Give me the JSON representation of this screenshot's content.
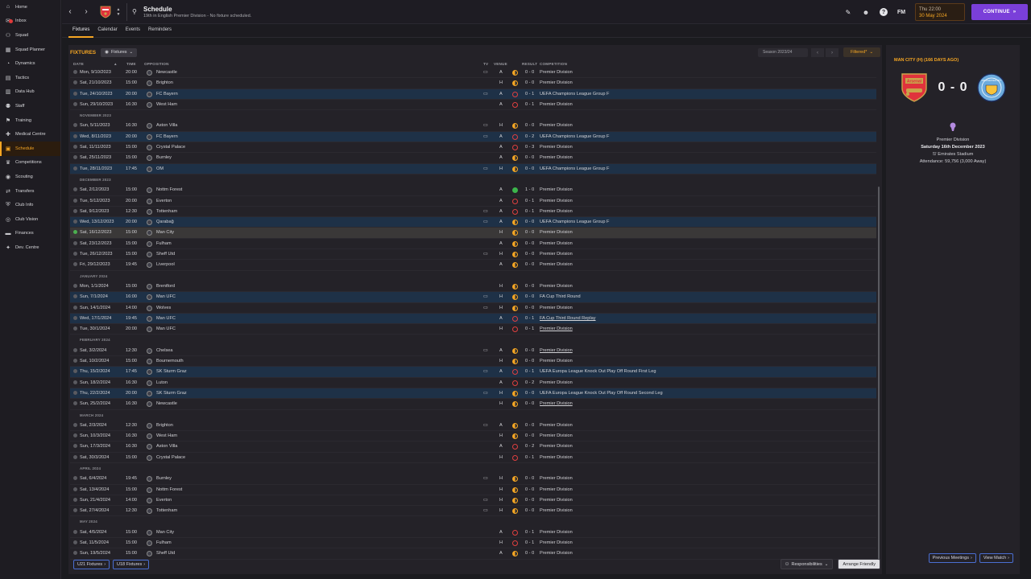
{
  "sidebar": {
    "items": [
      {
        "label": "Home",
        "icon": "home-icon",
        "glyph": "⌂"
      },
      {
        "label": "Inbox",
        "icon": "inbox-icon",
        "glyph": "✉",
        "badge": true
      },
      {
        "label": "Squad",
        "icon": "squad-icon",
        "glyph": "⚇"
      },
      {
        "label": "Squad Planner",
        "icon": "squad-planner-icon",
        "glyph": "▦"
      },
      {
        "label": "Dynamics",
        "icon": "dynamics-icon",
        "glyph": "◔"
      },
      {
        "label": "Tactics",
        "icon": "tactics-icon",
        "glyph": "▤"
      },
      {
        "label": "Data Hub",
        "icon": "data-hub-icon",
        "glyph": "▥"
      },
      {
        "label": "Staff",
        "icon": "staff-icon",
        "glyph": "⚉"
      },
      {
        "label": "Training",
        "icon": "training-icon",
        "glyph": "⚑"
      },
      {
        "label": "Medical Centre",
        "icon": "medical-icon",
        "glyph": "✚"
      },
      {
        "label": "Schedule",
        "icon": "calendar-icon",
        "glyph": "▣",
        "active": true
      },
      {
        "label": "Competitions",
        "icon": "trophy-icon",
        "glyph": "♛"
      },
      {
        "label": "Scouting",
        "icon": "scouting-icon",
        "glyph": "◉"
      },
      {
        "label": "Transfers",
        "icon": "transfers-icon",
        "glyph": "⇄"
      },
      {
        "label": "Club Info",
        "icon": "club-info-icon",
        "glyph": "⛨"
      },
      {
        "label": "Club Vision",
        "icon": "club-vision-icon",
        "glyph": "◎"
      },
      {
        "label": "Finances",
        "icon": "finances-icon",
        "glyph": "▬"
      },
      {
        "label": "Dev. Centre",
        "icon": "dev-centre-icon",
        "glyph": "✦"
      }
    ]
  },
  "header": {
    "title": "Schedule",
    "subtitle": "19th in English Premier Division - No fixture scheduled.",
    "date_time": "Thu 22:00",
    "date": "30 May 2024",
    "continue_label": "CONTINUE",
    "fm_label": "FM",
    "help_label": "?"
  },
  "tabs": [
    "Fixtures",
    "Calendar",
    "Events",
    "Reminders"
  ],
  "fixtures": {
    "title": "FIXTURES",
    "filter_label": "Fixtures",
    "season": "Season 2023/24",
    "filtered_label": "Filtered*",
    "columns": {
      "date": "DATE",
      "time": "TIME",
      "opposition": "OPPOSITION",
      "tv": "TV",
      "venue": "VENUE",
      "result": "RESULT",
      "competition": "COMPETITION"
    },
    "rows": [
      {
        "date": "Mon, 9/10/2023",
        "time": "20:00",
        "opp": "Newcastle",
        "tv": true,
        "venue": "A",
        "res": "D",
        "score": "0 - 0",
        "comp": "Premier Division"
      },
      {
        "date": "Sat, 21/10/2023",
        "time": "15:00",
        "opp": "Brighton",
        "tv": false,
        "venue": "H",
        "res": "D",
        "score": "0 - 0",
        "comp": "Premier Division"
      },
      {
        "date": "Tue, 24/10/2023",
        "time": "20:00",
        "opp": "FC Bayern",
        "tv": true,
        "venue": "A",
        "res": "L",
        "score": "0 - 1",
        "comp": "UEFA Champions League Group F",
        "uefa": true
      },
      {
        "date": "Sun, 29/10/2023",
        "time": "16:30",
        "opp": "West Ham",
        "tv": false,
        "venue": "A",
        "res": "L",
        "score": "0 - 1",
        "comp": "Premier Division"
      },
      {
        "section": "NOVEMBER 2023"
      },
      {
        "date": "Sun, 5/11/2023",
        "time": "16:30",
        "opp": "Aston Villa",
        "tv": true,
        "venue": "H",
        "res": "D",
        "score": "0 - 0",
        "comp": "Premier Division"
      },
      {
        "date": "Wed, 8/11/2023",
        "time": "20:00",
        "opp": "FC Bayern",
        "tv": true,
        "venue": "A",
        "res": "L",
        "score": "0 - 2",
        "comp": "UEFA Champions League Group F",
        "uefa": true
      },
      {
        "date": "Sat, 11/11/2023",
        "time": "15:00",
        "opp": "Crystal Palace",
        "tv": false,
        "venue": "A",
        "res": "L",
        "score": "0 - 3",
        "comp": "Premier Division"
      },
      {
        "date": "Sat, 25/11/2023",
        "time": "15:00",
        "opp": "Burnley",
        "tv": false,
        "venue": "A",
        "res": "D",
        "score": "0 - 0",
        "comp": "Premier Division"
      },
      {
        "date": "Tue, 28/11/2023",
        "time": "17:45",
        "opp": "OM",
        "tv": true,
        "venue": "H",
        "res": "D",
        "score": "0 - 0",
        "comp": "UEFA Champions League Group F",
        "uefa": true
      },
      {
        "section": "DECEMBER 2023"
      },
      {
        "date": "Sat, 2/12/2023",
        "time": "15:00",
        "opp": "Nottm Forest",
        "tv": false,
        "venue": "A",
        "res": "W",
        "score": "1 - 0",
        "comp": "Premier Division"
      },
      {
        "date": "Tue, 5/12/2023",
        "time": "20:00",
        "opp": "Everton",
        "tv": false,
        "venue": "A",
        "res": "L",
        "score": "0 - 1",
        "comp": "Premier Division"
      },
      {
        "date": "Sat, 9/12/2023",
        "time": "12:30",
        "opp": "Tottenham",
        "tv": true,
        "venue": "A",
        "res": "L",
        "score": "0 - 1",
        "comp": "Premier Division"
      },
      {
        "date": "Wed, 13/12/2023",
        "time": "20:00",
        "opp": "Qarabağ",
        "tv": true,
        "venue": "A",
        "res": "D",
        "score": "0 - 0",
        "comp": "UEFA Champions League Group F",
        "uefa": true
      },
      {
        "date": "Sat, 16/12/2023",
        "time": "15:00",
        "opp": "Man City",
        "tv": false,
        "venue": "H",
        "res": "D",
        "score": "0 - 0",
        "comp": "Premier Division",
        "selected": true
      },
      {
        "date": "Sat, 23/12/2023",
        "time": "15:00",
        "opp": "Fulham",
        "tv": false,
        "venue": "A",
        "res": "D",
        "score": "0 - 0",
        "comp": "Premier Division"
      },
      {
        "date": "Tue, 26/12/2023",
        "time": "15:00",
        "opp": "Sheff Utd",
        "tv": true,
        "venue": "H",
        "res": "D",
        "score": "0 - 0",
        "comp": "Premier Division"
      },
      {
        "date": "Fri, 29/12/2023",
        "time": "19:45",
        "opp": "Liverpool",
        "tv": false,
        "venue": "A",
        "res": "D",
        "score": "0 - 0",
        "comp": "Premier Division"
      },
      {
        "section": "JANUARY 2024"
      },
      {
        "date": "Mon, 1/1/2024",
        "time": "15:00",
        "opp": "Brentford",
        "tv": false,
        "venue": "H",
        "res": "D",
        "score": "0 - 0",
        "comp": "Premier Division"
      },
      {
        "date": "Sun, 7/1/2024",
        "time": "16:00",
        "opp": "Man UFC",
        "tv": true,
        "venue": "H",
        "res": "D",
        "score": "0 - 0",
        "comp": "FA Cup Third Round",
        "uefa": true
      },
      {
        "date": "Sun, 14/1/2024",
        "time": "14:00",
        "opp": "Wolves",
        "tv": true,
        "venue": "H",
        "res": "D",
        "score": "0 - 0",
        "comp": "Premier Division"
      },
      {
        "date": "Wed, 17/1/2024",
        "time": "19:45",
        "opp": "Man UFC",
        "tv": false,
        "venue": "A",
        "res": "L",
        "score": "0 - 1",
        "comp": "FA Cup Third Round Replay",
        "uefa": true,
        "underline": true
      },
      {
        "date": "Tue, 30/1/2024",
        "time": "20:00",
        "opp": "Man UFC",
        "tv": false,
        "venue": "H",
        "res": "L",
        "score": "0 - 1",
        "comp": "Premier Division",
        "underline": true
      },
      {
        "section": "FEBRUARY 2024"
      },
      {
        "date": "Sat, 3/2/2024",
        "time": "12:30",
        "opp": "Chelsea",
        "tv": true,
        "venue": "A",
        "res": "D",
        "score": "0 - 0",
        "comp": "Premier Division",
        "underline": true
      },
      {
        "date": "Sat, 10/2/2024",
        "time": "15:00",
        "opp": "Bournemouth",
        "tv": false,
        "venue": "H",
        "res": "D",
        "score": "0 - 0",
        "comp": "Premier Division"
      },
      {
        "date": "Thu, 15/2/2024",
        "time": "17:45",
        "opp": "SK Sturm Graz",
        "tv": true,
        "venue": "A",
        "res": "L",
        "score": "0 - 1",
        "comp": "UEFA Europa League Knock Out Play Off Round First Leg",
        "uefa": true
      },
      {
        "date": "Sun, 18/2/2024",
        "time": "16:30",
        "opp": "Luton",
        "tv": false,
        "venue": "A",
        "res": "L",
        "score": "0 - 2",
        "comp": "Premier Division"
      },
      {
        "date": "Thu, 22/2/2024",
        "time": "20:00",
        "opp": "SK Sturm Graz",
        "tv": true,
        "venue": "H",
        "res": "D",
        "score": "0 - 0",
        "comp": "UEFA Europa League Knock Out Play Off Round Second Leg",
        "uefa": true
      },
      {
        "date": "Sun, 25/2/2024",
        "time": "16:30",
        "opp": "Newcastle",
        "tv": false,
        "venue": "H",
        "res": "D",
        "score": "0 - 0",
        "comp": "Premier Division",
        "underline": true
      },
      {
        "section": "MARCH 2024"
      },
      {
        "date": "Sat, 2/3/2024",
        "time": "12:30",
        "opp": "Brighton",
        "tv": true,
        "venue": "A",
        "res": "D",
        "score": "0 - 0",
        "comp": "Premier Division"
      },
      {
        "date": "Sun, 10/3/2024",
        "time": "16:30",
        "opp": "West Ham",
        "tv": false,
        "venue": "H",
        "res": "D",
        "score": "0 - 0",
        "comp": "Premier Division"
      },
      {
        "date": "Sun, 17/3/2024",
        "time": "16:30",
        "opp": "Aston Villa",
        "tv": false,
        "venue": "A",
        "res": "L",
        "score": "0 - 2",
        "comp": "Premier Division"
      },
      {
        "date": "Sat, 30/3/2024",
        "time": "15:00",
        "opp": "Crystal Palace",
        "tv": false,
        "venue": "H",
        "res": "L",
        "score": "0 - 1",
        "comp": "Premier Division"
      },
      {
        "section": "APRIL 2024"
      },
      {
        "date": "Sat, 6/4/2024",
        "time": "19:45",
        "opp": "Burnley",
        "tv": true,
        "venue": "H",
        "res": "D",
        "score": "0 - 0",
        "comp": "Premier Division"
      },
      {
        "date": "Sat, 13/4/2024",
        "time": "15:00",
        "opp": "Nottm Forest",
        "tv": false,
        "venue": "H",
        "res": "D",
        "score": "0 - 0",
        "comp": "Premier Division"
      },
      {
        "date": "Sun, 21/4/2024",
        "time": "14:00",
        "opp": "Everton",
        "tv": true,
        "venue": "H",
        "res": "D",
        "score": "0 - 0",
        "comp": "Premier Division"
      },
      {
        "date": "Sat, 27/4/2024",
        "time": "12:30",
        "opp": "Tottenham",
        "tv": true,
        "venue": "H",
        "res": "D",
        "score": "0 - 0",
        "comp": "Premier Division"
      },
      {
        "section": "MAY 2024"
      },
      {
        "date": "Sat, 4/5/2024",
        "time": "15:00",
        "opp": "Man City",
        "tv": false,
        "venue": "A",
        "res": "L",
        "score": "0 - 1",
        "comp": "Premier Division"
      },
      {
        "date": "Sat, 11/5/2024",
        "time": "15:00",
        "opp": "Fulham",
        "tv": false,
        "venue": "H",
        "res": "L",
        "score": "0 - 1",
        "comp": "Premier Division"
      },
      {
        "date": "Sun, 19/5/2024",
        "time": "15:00",
        "opp": "Sheff Utd",
        "tv": false,
        "venue": "A",
        "res": "D",
        "score": "0 - 0",
        "comp": "Premier Division"
      }
    ]
  },
  "bottom": {
    "u21": "U21 Fixtures",
    "u18": "U18 Fixtures",
    "responsibilities": "Responsibilities",
    "arrange": "Arrange Friendly"
  },
  "match_panel": {
    "heading": "MAN CITY (H) (166 DAYS AGO)",
    "home_crest_text": "Arsenal",
    "away_crest_text": "MANCHESTER CITY",
    "score": "0 - 0",
    "competition": "Premier Division",
    "date": "Saturday 16th December 2023",
    "stadium": "Emirates Stadium",
    "attendance": "Attendance: 59,756 (3,000 Away)",
    "prev_btn": "Previous Meetings",
    "view_btn": "View Match"
  },
  "colors": {
    "accent": "#f5a623",
    "continue": "#7a3fd9",
    "uefa_row": "#1e3147",
    "win": "#3cb44b",
    "loss": "#e04040"
  }
}
